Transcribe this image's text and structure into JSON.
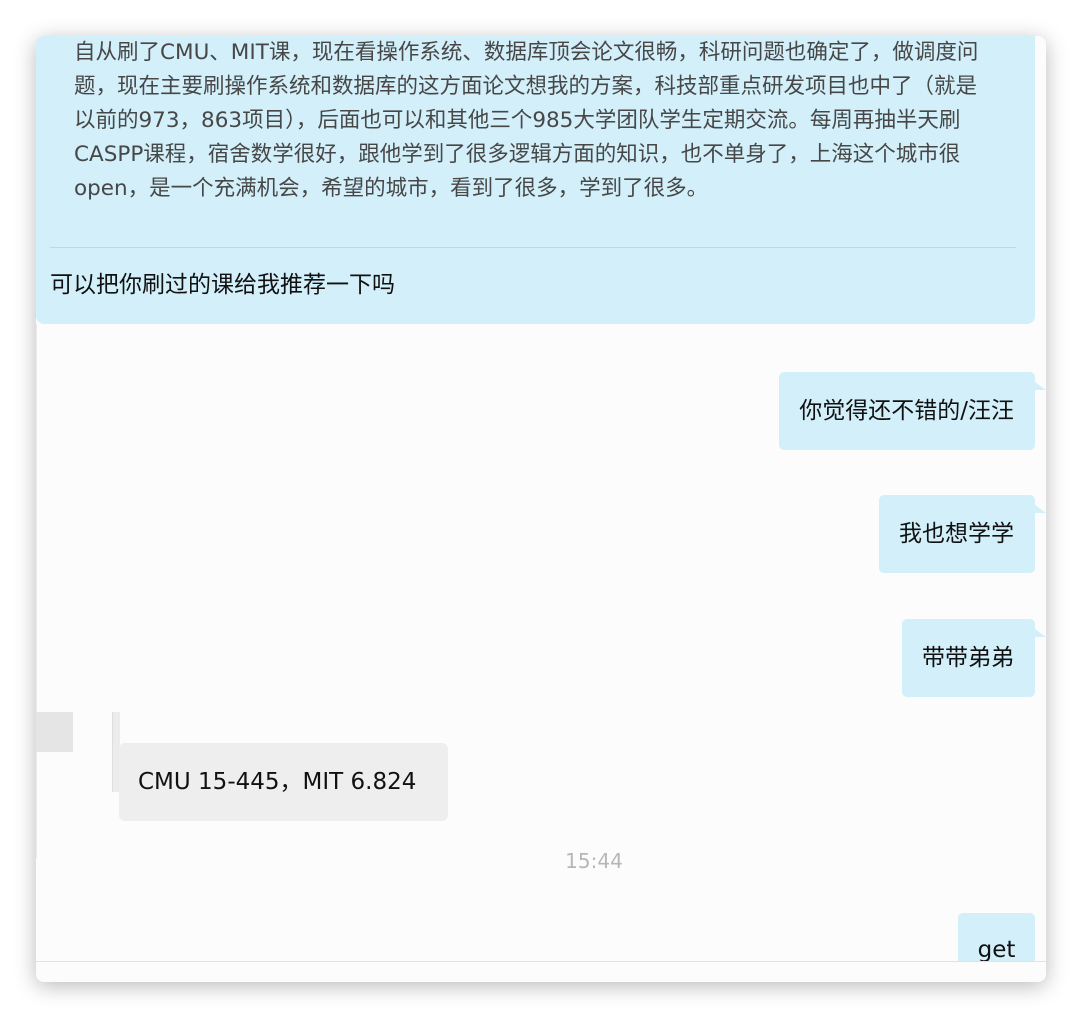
{
  "chat": {
    "quoted_message": "自从刷了CMU、MIT课，现在看操作系统、数据库顶会论文很畅，科研问题也确定了，做调度问题，现在主要刷操作系统和数据库的这方面论文想我的方案，科技部重点研发项目也中了（就是以前的973，863项目），后面也可以和其他三个985大学团队学生定期交流。每周再抽半天刷CASPP课程，宿舍数学很好，跟他学到了很多逻辑方面的知识，也不单身了，上海这个城市很open，是一个充满机会，希望的城市，看到了很多，学到了很多。",
    "reply_to_quote": "可以把你刷过的课给我推荐一下吗",
    "messages": [
      {
        "side": "out",
        "text": "你觉得还不错的/汪汪"
      },
      {
        "side": "out",
        "text": "我也想学学"
      },
      {
        "side": "out",
        "text": "带带弟弟"
      },
      {
        "side": "in",
        "text": "CMU 15-445，MIT 6.824"
      },
      {
        "side": "out",
        "text": "get"
      }
    ],
    "timestamp": "15:44"
  },
  "colors": {
    "outgoing_bubble": "#d2effa",
    "incoming_bubble": "#eeeeee",
    "timestamp_text": "#b7b7b7"
  }
}
